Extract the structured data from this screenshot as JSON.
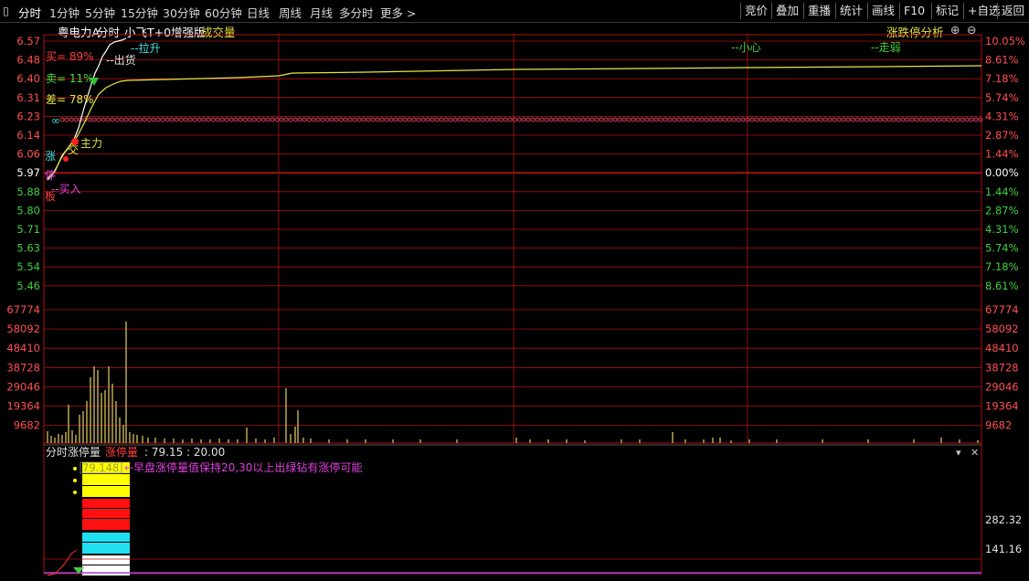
{
  "toolbar": {
    "periods": [
      "分时",
      "1分钟",
      "5分钟",
      "15分钟",
      "30分钟",
      "60分钟",
      "日线",
      "周线",
      "月线",
      "多分时",
      "更多 >"
    ],
    "buttons": [
      "竞价",
      "叠加",
      "重播",
      "统计",
      "画线",
      "F10",
      "标记",
      "+自选",
      "返回"
    ]
  },
  "header": {
    "stock_name": "粤电力A",
    "view": "分时",
    "indicator": "小飞T+0增强版",
    "volume_label": "成交量",
    "analysis_label": "涨跌停分析"
  },
  "price_axis": {
    "left": [
      "6.57",
      "6.48",
      "6.40",
      "6.31",
      "6.23",
      "6.14",
      "6.06",
      "5.97",
      "5.88",
      "5.80",
      "5.71",
      "5.63",
      "5.54",
      "5.46"
    ],
    "right": [
      "10.05%",
      "8.61%",
      "7.18%",
      "5.74%",
      "4.31%",
      "2.87%",
      "1.44%",
      "0.00%",
      "1.44%",
      "2.87%",
      "4.31%",
      "5.74%",
      "7.18%",
      "8.61%"
    ]
  },
  "volume_axis": [
    "67774",
    "58092",
    "48410",
    "38728",
    "29046",
    "19364",
    "9682"
  ],
  "annotations": {
    "buy_pct": "买= 89%",
    "sell_pct": "卖= 11%",
    "diff_pct": "差= 78%",
    "pull_up": "--拉升",
    "ship_out": "--出货",
    "careful": "--小心",
    "weak": "--走弱",
    "main_force": "主力",
    "buy_in": "--买入",
    "infinity": "∞",
    "zhang": "涨",
    "ting": "停",
    "ban": "板",
    "jian": "交"
  },
  "bottom_panel": {
    "title": "分时涨停量",
    "series_label": "涨停量",
    "series_values": ": 79.15 : 20.00",
    "value_tag": "79.148",
    "note": "←早盘涨停量值保持20,30以上出绿钻有涨停可能",
    "axis": [
      "282.32",
      "141.16"
    ]
  },
  "colors": {
    "grid": "#b01010",
    "price_line": "#ffffff",
    "avg_line": "#e6e640",
    "volume": "#c8b450",
    "accent_cyan": "#40e0e0",
    "accent_magenta": "#e040e0",
    "text_red": "#ff5050",
    "text_green": "#40d040"
  }
}
